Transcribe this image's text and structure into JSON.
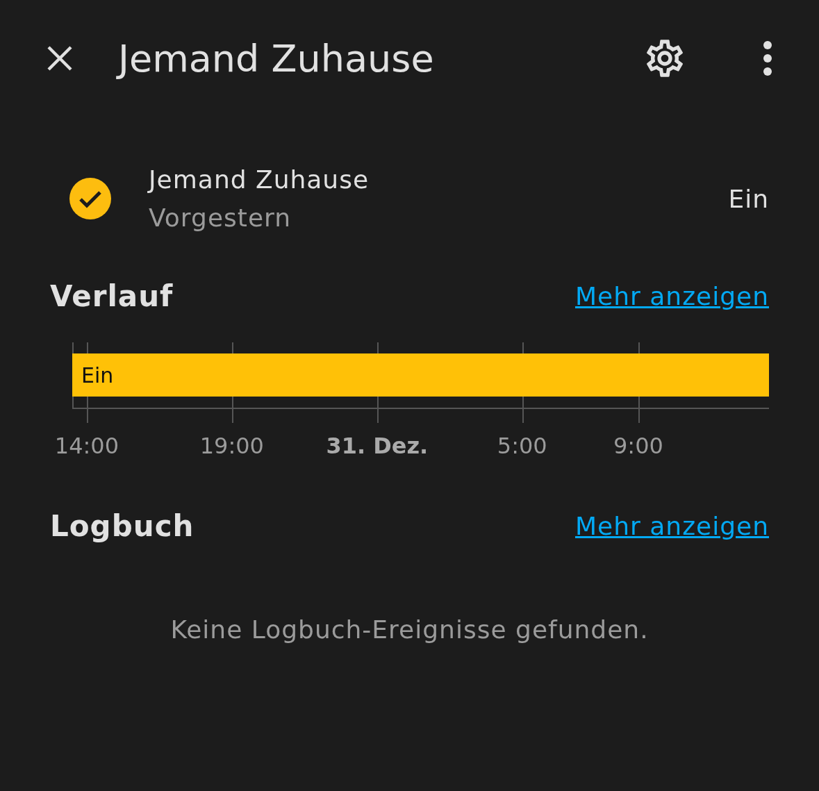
{
  "header": {
    "title": "Jemand Zuhause"
  },
  "entity": {
    "name": "Jemand Zuhause",
    "time": "Vorgestern",
    "state": "Ein",
    "on": true
  },
  "history": {
    "title": "Verlauf",
    "link": "Mehr anzeigen",
    "segments": [
      {
        "label": "Ein",
        "color": "#ffc107"
      }
    ],
    "ticks": [
      {
        "label": "14:00",
        "bold": false
      },
      {
        "label": "19:00",
        "bold": false
      },
      {
        "label": "31. Dez.",
        "bold": true
      },
      {
        "label": "5:00",
        "bold": false
      },
      {
        "label": "9:00",
        "bold": false
      }
    ]
  },
  "logbook": {
    "title": "Logbuch",
    "link": "Mehr anzeigen",
    "empty": "Keine Logbuch-Ereignisse gefunden."
  }
}
